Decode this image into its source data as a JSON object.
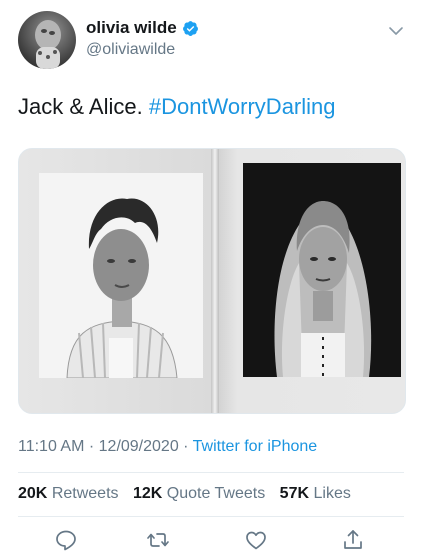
{
  "user": {
    "display_name": "olivia wilde",
    "handle": "@oliviawilde",
    "verified": true
  },
  "tweet": {
    "text_plain": "Jack & Alice. ",
    "hashtag": "#DontWorryDarling",
    "time": "11:10 AM",
    "separator": " · ",
    "date": "12/09/2020",
    "source": "Twitter for iPhone"
  },
  "stats": {
    "retweets_count": "20K",
    "retweets_label": "Retweets",
    "quote_count": "12K",
    "quote_label": "Quote Tweets",
    "likes_count": "57K",
    "likes_label": "Likes"
  },
  "icons": {
    "reply": "reply-icon",
    "retweet": "retweet-icon",
    "like": "like-icon",
    "share": "share-icon",
    "more": "chevron-down-icon",
    "verified": "verified-badge-icon"
  },
  "colors": {
    "link": "#1b95e0",
    "secondary_text": "#657786",
    "primary_text": "#14171a",
    "verified_badge": "#1da1f2"
  }
}
